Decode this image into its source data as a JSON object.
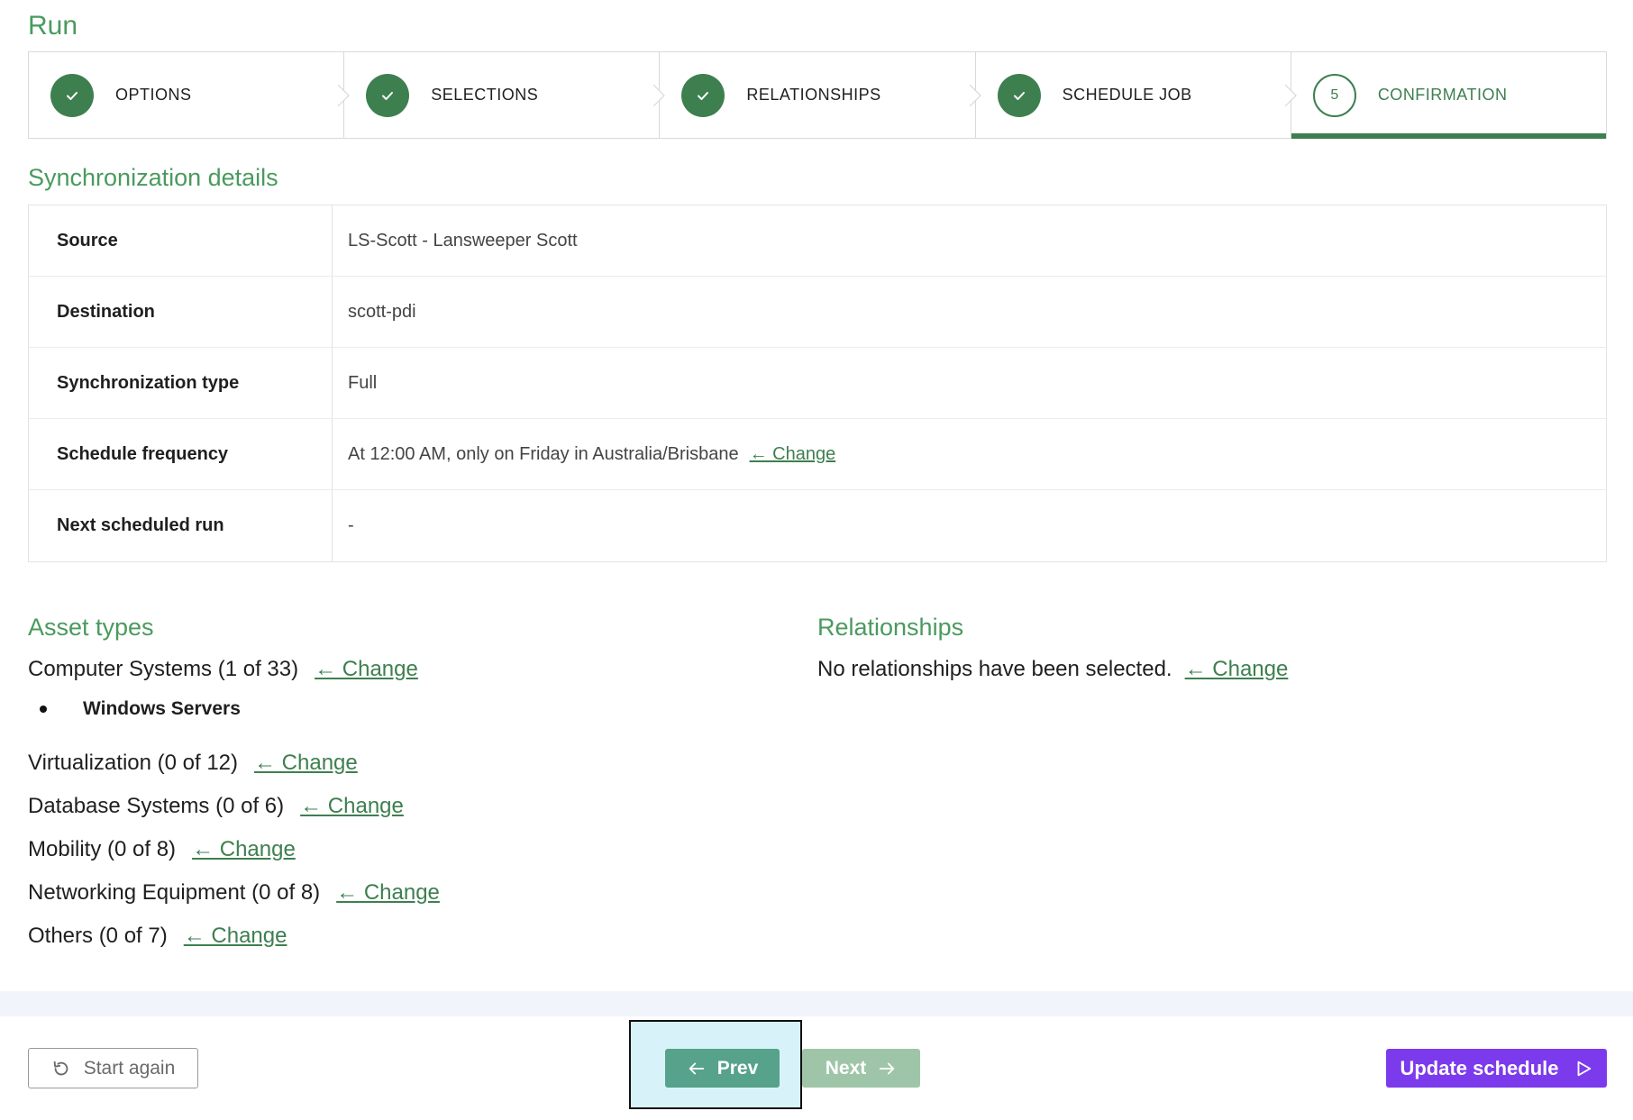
{
  "page": {
    "title": "Run"
  },
  "stepper": {
    "steps": [
      {
        "label": "OPTIONS",
        "state": "done"
      },
      {
        "label": "SELECTIONS",
        "state": "done"
      },
      {
        "label": "RELATIONSHIPS",
        "state": "done"
      },
      {
        "label": "SCHEDULE JOB",
        "state": "done"
      },
      {
        "label": "CONFIRMATION",
        "state": "active",
        "number": "5"
      }
    ]
  },
  "sync": {
    "title": "Synchronization details",
    "rows": [
      {
        "label": "Source",
        "value": "LS-Scott - Lansweeper Scott"
      },
      {
        "label": "Destination",
        "value": "scott-pdi"
      },
      {
        "label": "Synchronization type",
        "value": "Full"
      },
      {
        "label": "Schedule frequency",
        "value": "At 12:00 AM, only on Friday in Australia/Brisbane",
        "change": "← Change"
      },
      {
        "label": "Next scheduled run",
        "value": "-"
      }
    ]
  },
  "assets": {
    "title": "Asset types",
    "items": [
      {
        "label": "Computer Systems (1 of 33)",
        "change": "← Change"
      },
      {
        "label": "Virtualization (0 of 12)",
        "change": "← Change"
      },
      {
        "label": "Database Systems (0 of 6)",
        "change": "← Change"
      },
      {
        "label": "Mobility (0 of 8)",
        "change": "← Change"
      },
      {
        "label": "Networking Equipment (0 of 8)",
        "change": "← Change"
      },
      {
        "label": "Others (0 of 7)",
        "change": "← Change"
      }
    ],
    "selected": [
      "Windows Servers"
    ]
  },
  "relationships": {
    "title": "Relationships",
    "text": "No relationships have been selected.",
    "change": "← Change"
  },
  "footer": {
    "start_again": "Start again",
    "prev": "Prev",
    "next": "Next",
    "update": "Update schedule"
  },
  "colors": {
    "accent_green": "#3e7f4f",
    "title_green": "#4a9a5e",
    "update_purple": "#7c3aed"
  }
}
